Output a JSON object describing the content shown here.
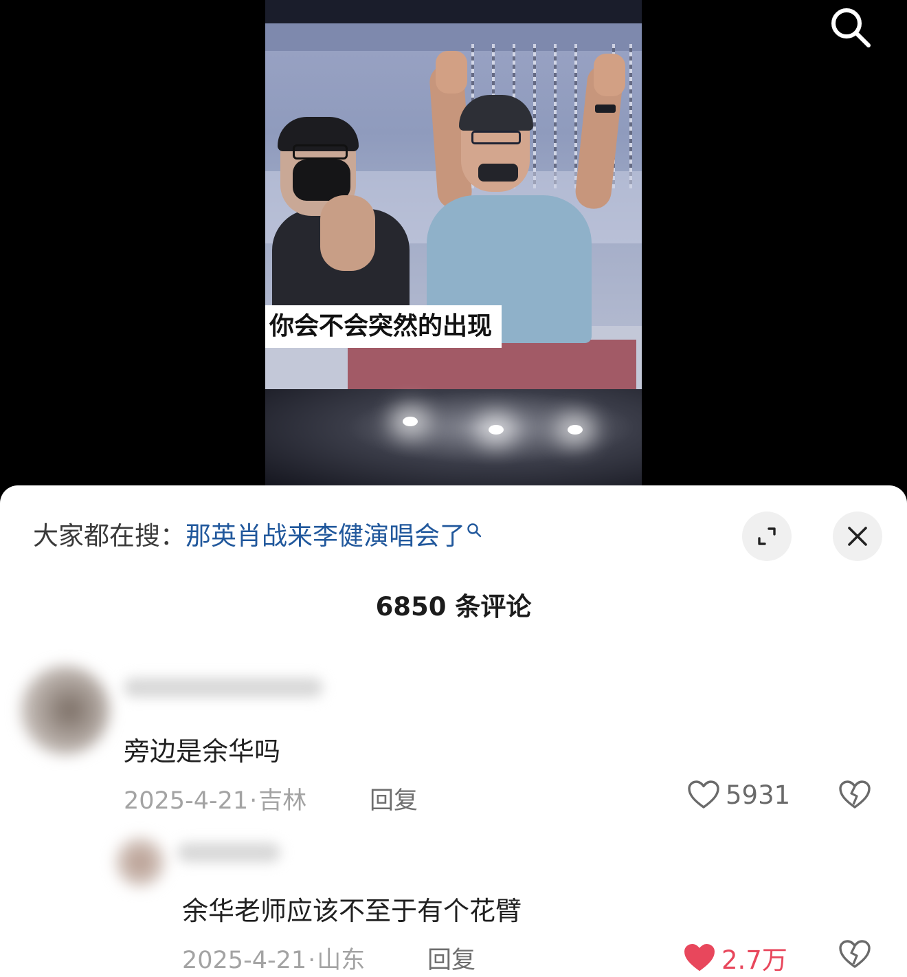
{
  "video": {
    "subtitle": "你会不会突然的出现"
  },
  "top": {
    "search_icon": "search-icon"
  },
  "panel": {
    "hot_search_prefix": "大家都在搜：",
    "hot_search_keyword": "那英肖战来李健演唱会了",
    "expand_icon": "expand-icon",
    "close_icon": "close-icon",
    "comment_count": "6850 条评论"
  },
  "comments": [
    {
      "text": "旁边是余华吗",
      "date": "2025-4-21",
      "location": "吉林",
      "reply_label": "回复",
      "likes": "5931",
      "liked": false
    },
    {
      "text": "余华老师应该不至于有个花臂",
      "date": "2025-4-21",
      "location": "山东",
      "reply_label": "回复",
      "likes": "2.7万",
      "liked": true
    }
  ],
  "colors": {
    "keyword": "#21589c",
    "liked_heart": "#e8475c"
  }
}
